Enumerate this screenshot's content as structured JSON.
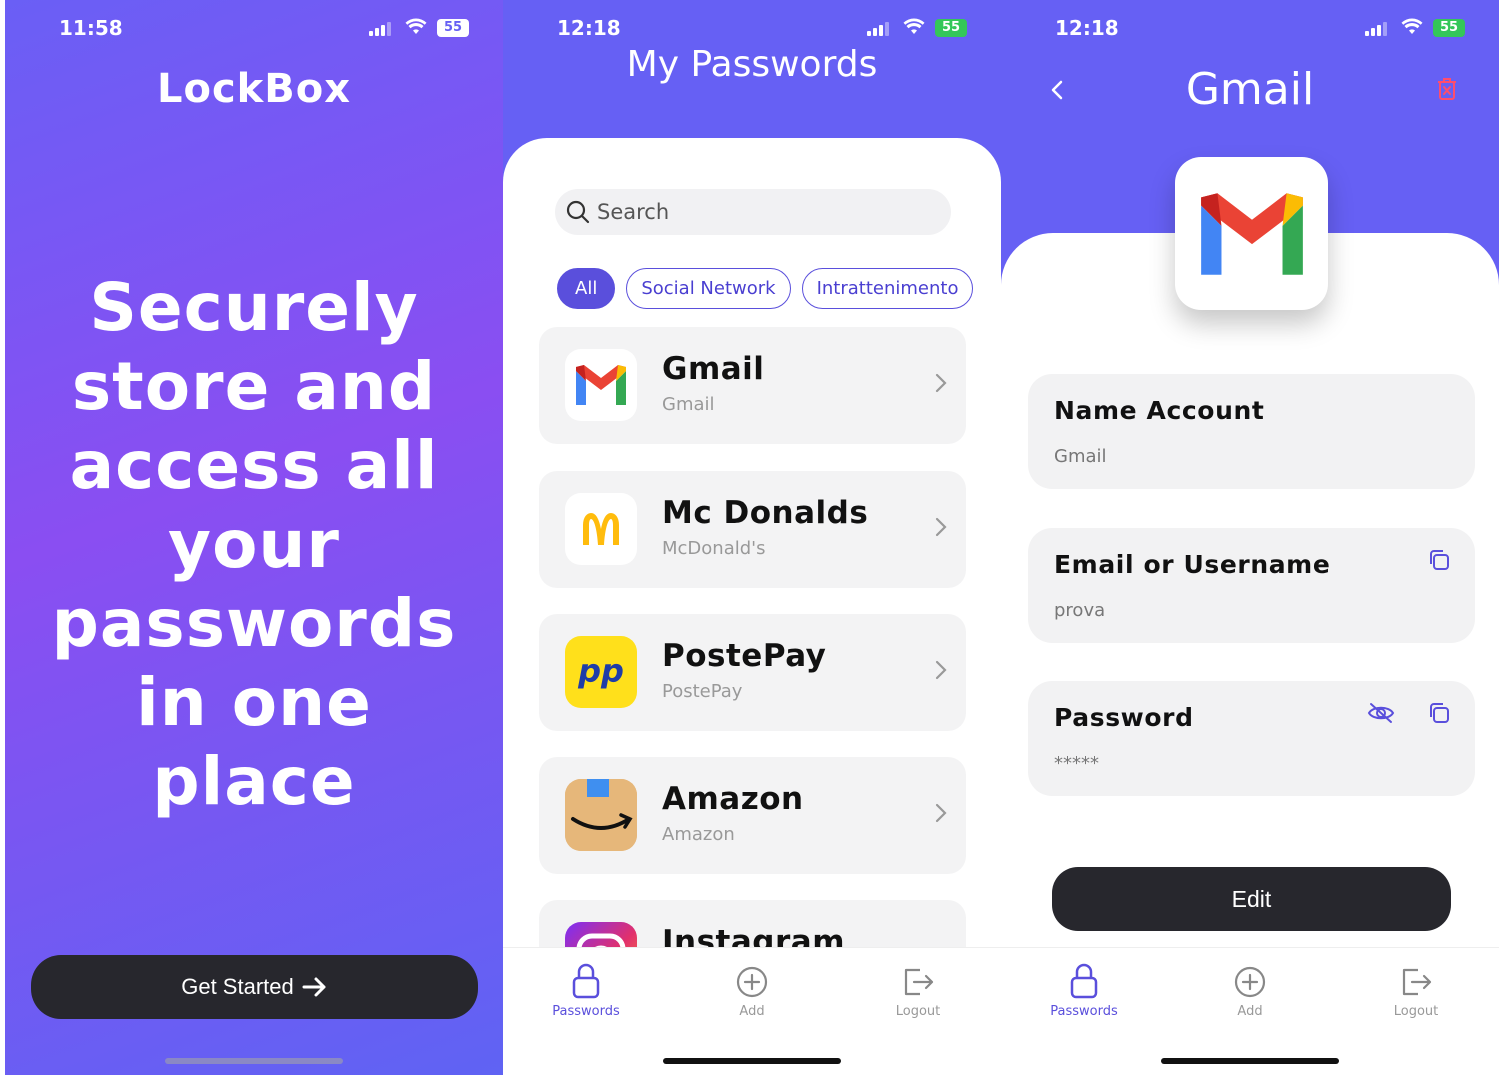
{
  "screen1": {
    "status": {
      "time": "11:58",
      "battery": "55"
    },
    "brand": "LockBox",
    "headline": "Securely store and access all your passwords in one place",
    "cta_label": "Get Started",
    "cta_icon": "arrow-right-icon"
  },
  "screen2": {
    "status": {
      "time": "12:18",
      "battery": "55"
    },
    "title": "My Passwords",
    "search_placeholder": "Search",
    "filters": [
      "All",
      "Social Network",
      "Intrattenimento"
    ],
    "items": [
      {
        "name": "Gmail",
        "subtitle": "Gmail",
        "icon": "gmail-logo-icon"
      },
      {
        "name": "Mc Donalds",
        "subtitle": "McDonald's",
        "icon": "mcdonalds-logo-icon"
      },
      {
        "name": "PostePay",
        "subtitle": "PostePay",
        "icon": "postepay-logo-icon"
      },
      {
        "name": "Amazon",
        "subtitle": "Amazon",
        "icon": "amazon-logo-icon"
      },
      {
        "name": "Instagram",
        "subtitle": "",
        "icon": "instagram-logo-icon"
      }
    ],
    "tabs": [
      {
        "label": "Passwords",
        "icon": "lock-icon",
        "active": true
      },
      {
        "label": "Add",
        "icon": "plus-circle-icon",
        "active": false
      },
      {
        "label": "Logout",
        "icon": "logout-icon",
        "active": false
      }
    ]
  },
  "screen3": {
    "status": {
      "time": "12:18",
      "battery": "55"
    },
    "title": "Gmail",
    "fields": [
      {
        "label": "Name Account",
        "value": "Gmail"
      },
      {
        "label": "Email or Username",
        "value": "prova"
      },
      {
        "label": "Password",
        "value": "*****"
      }
    ],
    "edit_label": "Edit",
    "tabs": [
      {
        "label": "Passwords",
        "icon": "lock-icon",
        "active": true
      },
      {
        "label": "Add",
        "icon": "plus-circle-icon",
        "active": false
      },
      {
        "label": "Logout",
        "icon": "logout-icon",
        "active": false
      }
    ]
  },
  "colors": {
    "accent": "#6660f4",
    "active_chip": "#5a4fdc",
    "dark_button": "#27272d",
    "delete": "#ff4d6d"
  }
}
